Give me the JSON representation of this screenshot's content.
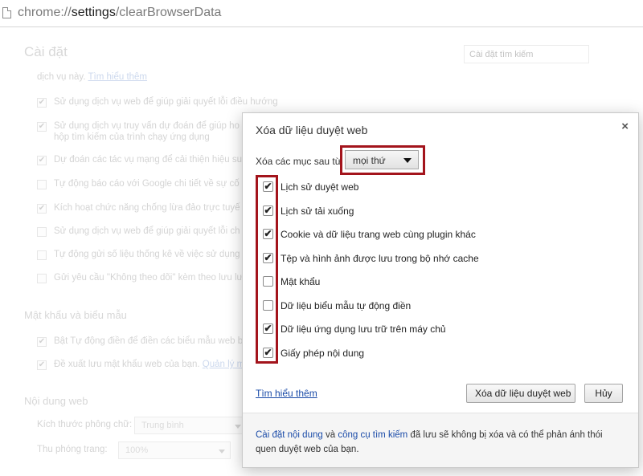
{
  "address_bar": {
    "scheme": "chrome://",
    "host": "settings",
    "path": "/clearBrowserData"
  },
  "settings_page": {
    "title": "Cài đặt",
    "search_placeholder": "Cài đặt tìm kiếm",
    "privacy_intro": "dịch vụ này.",
    "privacy_learn_more": "Tìm hiểu thêm",
    "privacy_options": [
      {
        "label": "Sử dụng dịch vụ web để giúp giải quyết lỗi điều hướng",
        "checked": true
      },
      {
        "label": "Sử dụng dịch vụ truy vấn dự đoán để giúp ho",
        "label2": "hộp tìm kiếm của trình chạy ứng dụng",
        "checked": true
      },
      {
        "label": "Dự đoán các tác vụ mạng để cải thiện hiệu su",
        "checked": true
      },
      {
        "label": "Tự động báo cáo với Google chi tiết về sự cố",
        "checked": false
      },
      {
        "label": "Kích hoạt chức năng chống lừa đảo trực tuyế",
        "checked": true
      },
      {
        "label": "Sử dụng dịch vụ web để giúp giải quyết lỗi ch",
        "checked": false
      },
      {
        "label": "Tự động gửi số liệu thống kê về việc sử dụng",
        "checked": false
      },
      {
        "label": "Gửi yêu cầu \"Không theo dõi\" kèm theo lưu lư",
        "checked": false
      }
    ],
    "passwords_section": "Mật khẩu và biểu mẫu",
    "passwords_options": [
      {
        "label": "Bật Tự động điền để điền các biểu mẫu web b",
        "checked": true
      },
      {
        "label": "Đề xuất lưu mật khẩu web của bạn.",
        "link": "Quản lý m",
        "checked": true
      }
    ],
    "web_content_section": "Nội dung web",
    "font_size_label": "Kích thước phông chữ:",
    "font_size_value": "Trung bình",
    "zoom_label": "Thu phóng trang:",
    "zoom_value": "100%"
  },
  "dialog": {
    "title": "Xóa dữ liệu duyệt web",
    "close_symbol": "×",
    "clear_label": "Xóa các mục sau từ",
    "time_range": "mọi thứ",
    "options": [
      {
        "label": "Lịch sử duyệt web",
        "checked": true
      },
      {
        "label": "Lịch sử tải xuống",
        "checked": true
      },
      {
        "label": "Cookie và dữ liệu trang web cùng plugin khác",
        "checked": true
      },
      {
        "label": "Tệp và hình ảnh được lưu trong bộ nhớ cache",
        "checked": true
      },
      {
        "label": "Mật khẩu",
        "checked": false
      },
      {
        "label": "Dữ liệu biểu mẫu tự động điền",
        "checked": false
      },
      {
        "label": "Dữ liệu ứng dụng lưu trữ trên máy chủ",
        "checked": true
      },
      {
        "label": "Giấy phép nội dung",
        "checked": true
      }
    ],
    "learn_more": "Tìm hiểu thêm",
    "clear_button": "Xóa dữ liệu duyệt web",
    "cancel_button": "Hủy",
    "footer": {
      "link1": "Cài đặt nội dung",
      "conj": " và ",
      "link2": "công cụ tìm kiếm",
      "text": " đã lưu sẽ không bị xóa và có thể phản ánh thói quen duyệt web của bạn."
    },
    "highlight_color": "#a3141c"
  }
}
